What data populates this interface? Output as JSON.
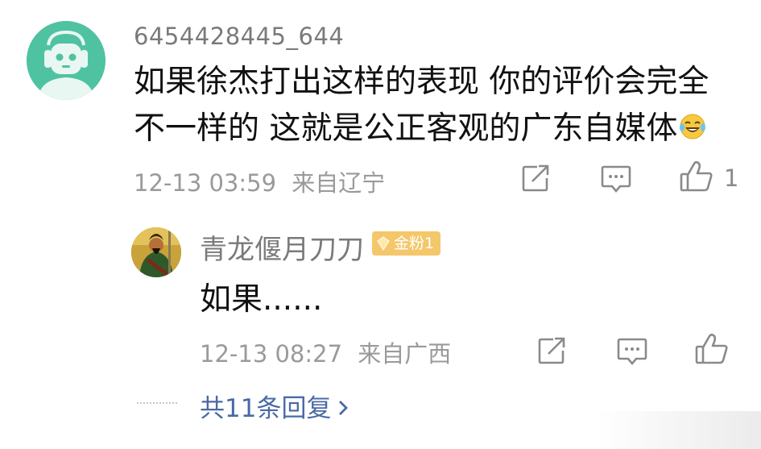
{
  "main_comment": {
    "username": "6454428445_644",
    "text_line1": "如果徐杰打出这样的表现 你的评价会完全",
    "text_line2": "不一样的 这就是公正客观的广东自媒体",
    "emoji": "tears-of-joy-emoji",
    "timestamp": "12-13 03:59",
    "location": "来自辽宁",
    "like_count": "1"
  },
  "reply": {
    "username": "青龙偃月刀刀",
    "badge": "金粉1",
    "text": "如果......",
    "timestamp": "12-13 08:27",
    "location": "来自广西"
  },
  "more_replies": {
    "label": "共11条回复"
  },
  "icons": {
    "share": "share-icon",
    "comment": "comment-icon",
    "like": "thumbs-up-icon",
    "chevron": "chevron-right-icon"
  },
  "colors": {
    "avatar_bg": "#4fc3a1",
    "link": "#4a6aa5",
    "badge": "#f4c76a",
    "meta": "#9a9a9a"
  }
}
